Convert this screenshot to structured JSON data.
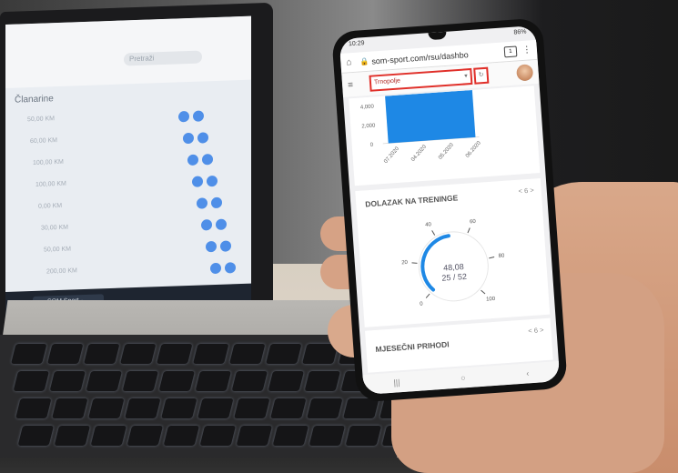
{
  "laptop": {
    "search_placeholder": "Pretraži",
    "heading": "Članarine",
    "amounts": [
      "50,00 KM",
      "60,00 KM",
      "100,00 KM",
      "100,00 KM",
      "0,00 KM",
      "30,00 KM",
      "50,00 KM",
      "200,00 KM"
    ],
    "taskbar_item": "SOM Sport - Google"
  },
  "phone": {
    "status_time": "10:29",
    "status_right": "86%",
    "url": "som-sport.com/rsu/dashbo",
    "tabs_count": "1",
    "select_value": "Trnopolje",
    "chart1": {
      "y_ticks": [
        "4,000",
        "2,000",
        "0"
      ],
      "x_ticks": [
        "07.2020",
        "04.2020",
        "05.2020",
        "06.2020"
      ]
    },
    "card2": {
      "title": "DOLAZAK NA TRENINGE",
      "pager": "< 6 >",
      "gauge_ticks": [
        "0",
        "20",
        "40",
        "60",
        "80",
        "100"
      ],
      "gauge_value": "48,08",
      "gauge_ratio": "25 / 52",
      "gauge_fraction": 0.4808
    },
    "card3": {
      "title": "MJESEČNI PRIHODI",
      "pager": "< 6 >"
    },
    "nav": {
      "recent": "|||",
      "home": "○",
      "back": "‹"
    }
  },
  "colors": {
    "accent_blue": "#1e88e5",
    "highlight_red": "#e0302a"
  }
}
